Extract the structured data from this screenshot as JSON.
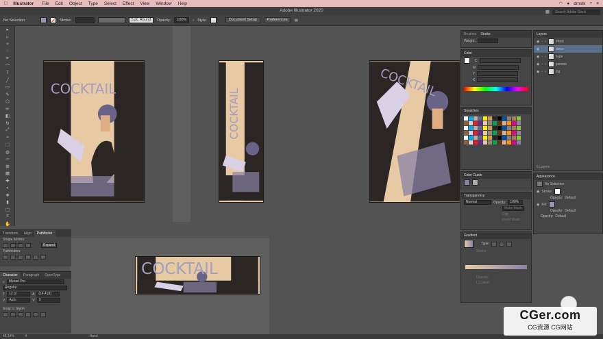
{
  "menubar": {
    "app": "Illustrator",
    "items": [
      "File",
      "Edit",
      "Object",
      "Type",
      "Select",
      "Effect",
      "View",
      "Window",
      "Help"
    ],
    "user": "dmstk"
  },
  "window": {
    "title": "Adobe Illustrator 2020",
    "search_placeholder": "Search Adobe Stock"
  },
  "control": {
    "selection": "No Selection",
    "stroke_label": "Stroke:",
    "brush": "5 pt. Round",
    "opacity_label": "Opacity:",
    "opacity_value": "100%",
    "style_label": "Style:",
    "doc_setup": "Document Setup",
    "preferences": "Preferences"
  },
  "tools": [
    "selection",
    "direct-selection",
    "magic-wand",
    "lasso",
    "pen",
    "curvature",
    "type",
    "line",
    "rectangle",
    "paintbrush",
    "shaper",
    "pencil",
    "eraser",
    "rotate",
    "scale",
    "width",
    "free-transform",
    "shape-builder",
    "perspective",
    "mesh",
    "gradient",
    "eyedropper",
    "blend",
    "symbol",
    "graph",
    "artboard",
    "slice",
    "hand",
    "zoom",
    "more"
  ],
  "artwork": {
    "word": "COCKTAIL"
  },
  "left_panels": {
    "tabs1": [
      "Transform",
      "Align",
      "Pathfinder"
    ],
    "shape_modes": "Shape Modes:",
    "expand": "Expand",
    "pathfinders": "Pathfinders:",
    "tabs2": [
      "Character",
      "Paragraph",
      "OpenType"
    ],
    "font": "Myriad Pro",
    "style": "Regular",
    "size": "12 pt",
    "leading": "(14,4 pt)",
    "kerning": "Auto",
    "tracking": "0",
    "snap": "Snap to Glyph"
  },
  "right_panels": {
    "brushes_tabs": [
      "Brushes",
      "Stroke"
    ],
    "weight_label": "Weight:",
    "color": "Color",
    "swatches": "Swatches",
    "color_guide": "Color Guide",
    "transparency": "Transparency",
    "blend_mode": "Normal",
    "t_opacity_label": "Opacity:",
    "t_opacity": "100%",
    "make_mask": "Make Mask",
    "clip": "Clip",
    "invert": "Invert Mask",
    "gradient": "Gradient",
    "type_label": "Type:",
    "stroke_g": "Stroke:",
    "opacity_g": "Opacity:",
    "location_g": "Location:",
    "layers": "Layers",
    "layer_names": [
      "Ptnik",
      "deco",
      "type",
      "person",
      "bg"
    ],
    "layers_count": "5 Layers",
    "appearance": "Appearance",
    "ap_no_sel": "No Selection",
    "ap_stroke": "Stroke:",
    "ap_opacity": "Opacity:",
    "ap_default": "Default",
    "ap_fill": "Fill:"
  },
  "status": {
    "zoom": "48,14%",
    "page": "4",
    "tool": "Hand"
  },
  "watermark": {
    "big": "CGer.com",
    "small": "CG资源 CG网站"
  },
  "colors": {
    "cream": "#e7c9a3",
    "dark": "#2b2623",
    "lavender": "#8a82a6"
  }
}
